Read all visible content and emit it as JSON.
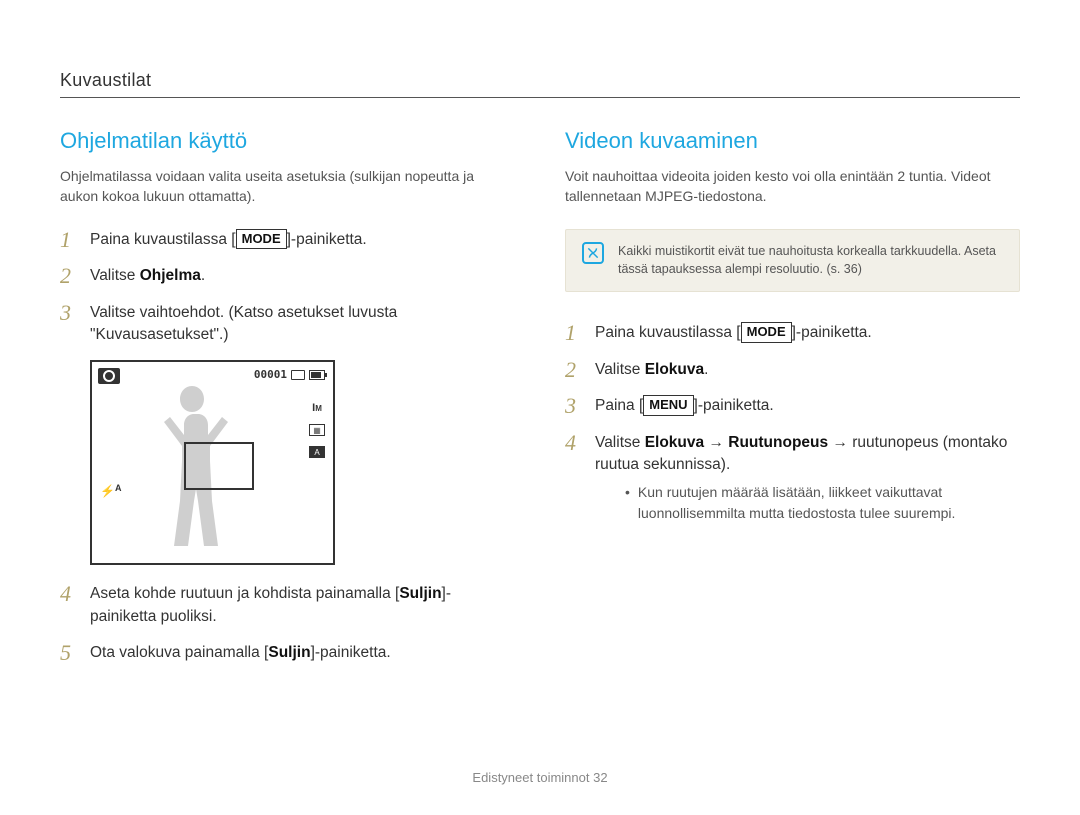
{
  "header": {
    "section": "Kuvaustilat"
  },
  "left": {
    "title": "Ohjelmatilan käyttö",
    "desc": "Ohjelmatilassa voidaan valita useita asetuksia (sulkijan nopeutta ja aukon kokoa lukuun ottamatta).",
    "steps": {
      "s1_a": "Paina kuvaustilassa [",
      "s1_btn": "MODE",
      "s1_b": "]-painiketta.",
      "s2_a": "Valitse ",
      "s2_bold": "Ohjelma",
      "s2_b": ".",
      "s3": "Valitse vaihtoehdot. (Katso asetukset luvusta \"Kuvausasetukset\".)",
      "s4_a": "Aseta kohde ruutuun ja kohdista painamalla [",
      "s4_bold": "Suljin",
      "s4_b": "]-painiketta puoliksi.",
      "s5_a": "Ota valokuva painamalla [",
      "s5_bold": "Suljin",
      "s5_b": "]-painiketta."
    },
    "screen": {
      "counter": "00001"
    }
  },
  "right": {
    "title": "Videon kuvaaminen",
    "desc": "Voit nauhoittaa videoita joiden kesto voi olla enintään 2 tuntia. Videot tallennetaan MJPEG-tiedostona.",
    "note": "Kaikki muistikortit eivät tue nauhoitusta korkealla tarkkuudella. Aseta tässä tapauksessa alempi resoluutio. (s. 36)",
    "steps": {
      "s1_a": "Paina kuvaustilassa [",
      "s1_btn": "MODE",
      "s1_b": "]-painiketta.",
      "s2_a": "Valitse ",
      "s2_bold": "Elokuva",
      "s2_b": ".",
      "s3_a": "Paina [",
      "s3_btn": "MENU",
      "s3_b": "]-painiketta.",
      "s4_a": "Valitse ",
      "s4_b1": "Elokuva",
      "s4_arrow1": " → ",
      "s4_b2": "Ruutunopeus",
      "s4_arrow2": " → ",
      "s4_c": "ruutunopeus (montako ruutua sekunnissa).",
      "bullet": "Kun ruutujen määrää lisätään, liikkeet vaikuttavat luonnollisemmilta mutta tiedostosta tulee suurempi."
    }
  },
  "footer": {
    "chapter": "Edistyneet toiminnot",
    "page": "32"
  }
}
